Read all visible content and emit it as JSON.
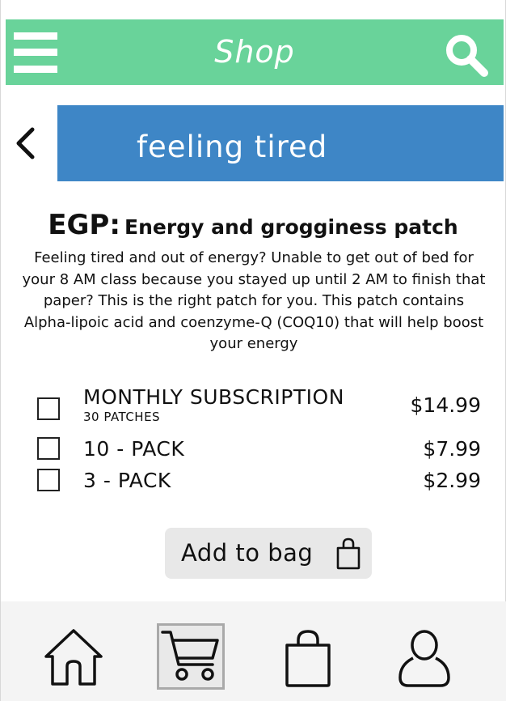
{
  "header": {
    "title": "Shop",
    "menu_icon": "hamburger-menu-icon",
    "search_icon": "search-icon",
    "color": "#69d39a"
  },
  "category": {
    "back_icon": "chevron-left-icon",
    "label": "feeling tired",
    "color": "#3e86c6"
  },
  "product": {
    "code": "EGP:",
    "name": "Energy and grogginess patch",
    "description": "Feeling tired and out of energy? Unable to get out of bed for your 8 AM class because you stayed up until 2 AM to finish that paper? This is the right patch for you. This patch contains Alpha-lipoic acid and coenzyme-Q (COQ10) that will help boost your energy"
  },
  "options": [
    {
      "label": "MONTHLY SUBSCRIPTION",
      "sublabel": "30 PATCHES",
      "price": "$14.99",
      "checked": false
    },
    {
      "label": "10 - PACK",
      "price": "$7.99",
      "checked": false
    },
    {
      "label": "3 - PACK",
      "price": "$2.99",
      "checked": false
    }
  ],
  "add_button": {
    "label": "Add to bag",
    "icon": "shopping-bag-icon"
  },
  "bottom_nav": {
    "items": [
      {
        "name": "home",
        "icon": "home-icon",
        "active": false
      },
      {
        "name": "cart",
        "icon": "cart-icon",
        "active": true
      },
      {
        "name": "bag",
        "icon": "shopping-bag-icon",
        "active": false
      },
      {
        "name": "profile",
        "icon": "user-icon",
        "active": false
      }
    ]
  }
}
